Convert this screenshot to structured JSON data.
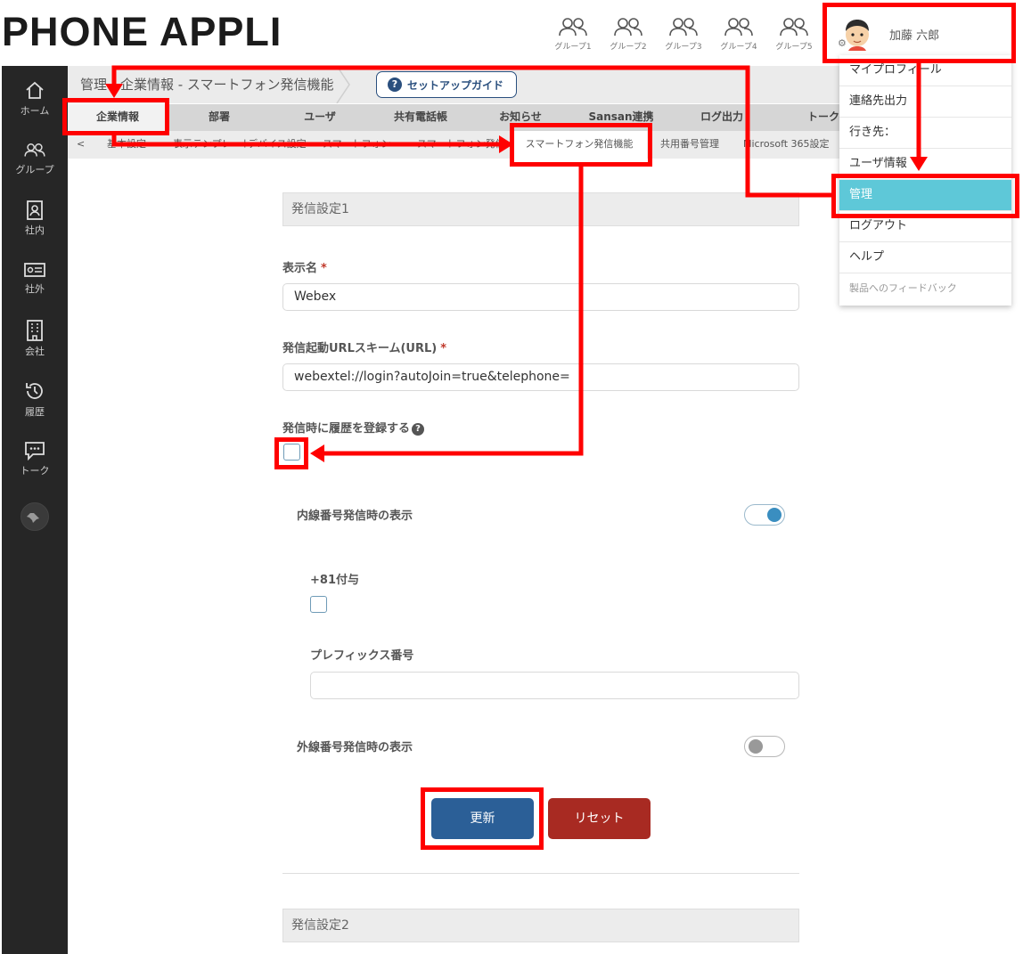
{
  "logo": "PHONE APPLI",
  "groups": [
    {
      "label": "グループ1"
    },
    {
      "label": "グループ2"
    },
    {
      "label": "グループ3"
    },
    {
      "label": "グループ4"
    },
    {
      "label": "グループ5"
    }
  ],
  "user": {
    "name": "加藤 六郎"
  },
  "sidebar": [
    {
      "label": "ホーム",
      "icon": "home-icon"
    },
    {
      "label": "グループ",
      "icon": "group-icon"
    },
    {
      "label": "社内",
      "icon": "internal-contacts-icon"
    },
    {
      "label": "社外",
      "icon": "external-contacts-icon"
    },
    {
      "label": "会社",
      "icon": "company-icon"
    },
    {
      "label": "履歴",
      "icon": "history-icon"
    },
    {
      "label": "トーク",
      "icon": "talk-icon"
    }
  ],
  "breadcrumb": "管理 - 企業情報 - スマートフォン発信機能",
  "setup_guide": "セットアップガイド",
  "tabs": [
    "企業情報",
    "部署",
    "ユーザ",
    "共有電話帳",
    "お知らせ",
    "Sansan連携",
    "ログ出力",
    "トーク"
  ],
  "subtabs": {
    "prev": "<",
    "items": [
      "基本設定",
      "表示テンプレート",
      "デバイス設定",
      "スマートフォン",
      "スマートフォン発信",
      "スマートフォン発信機能",
      "共用番号管理",
      "Microsoft 365設定"
    ]
  },
  "menu": {
    "items": [
      "マイプロフィール",
      "連絡先出力",
      "行き先：",
      "ユーザ情報",
      "管理",
      "ログアウト",
      "ヘルプ",
      "製品へのフィードバック"
    ]
  },
  "form": {
    "section1": "発信設定1",
    "display_name_label": "表示名",
    "display_name_value": "Webex",
    "url_label": "発信起動URLスキーム(URL)",
    "url_value": "webextel://login?autoJoin=true&telephone=",
    "history_label": "発信時に履歴を登録する",
    "extension_label": "内線番号発信時の表示",
    "plus81_label": "+81付与",
    "prefix_label": "プレフィックス番号",
    "prefix_value": "",
    "external_label": "外線番号発信時の表示",
    "update_button": "更新",
    "reset_button": "リセット",
    "section2": "発信設定2",
    "required_mark": "*",
    "help_mark": "?"
  },
  "colors": {
    "annotation": "#ff0000",
    "menu_active": "#5ec8d8",
    "update": "#2b5f97",
    "reset": "#a82a22",
    "sidebar": "#262626"
  }
}
